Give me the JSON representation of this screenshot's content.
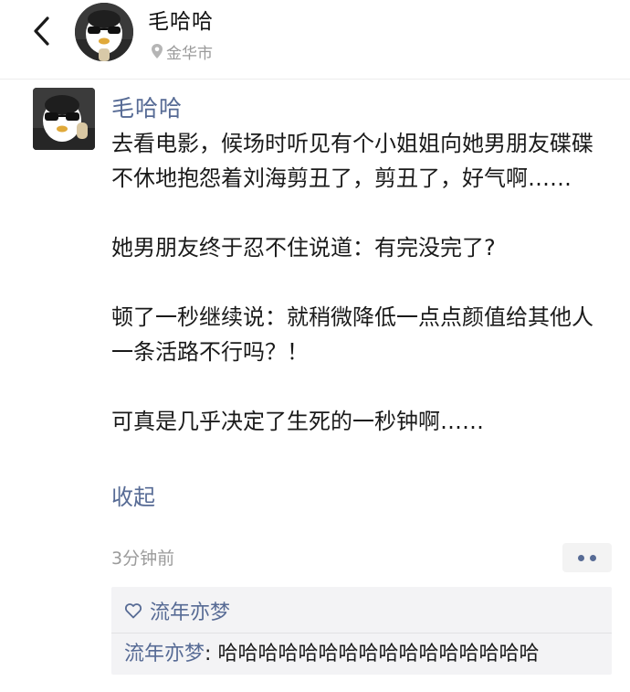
{
  "header": {
    "name": "毛哈哈",
    "location": "金华市",
    "icons": {
      "back": "chevron-left-icon",
      "location": "location-pin-icon"
    }
  },
  "post": {
    "author": "毛哈哈",
    "paragraphs": [
      "去看电影，候场时听见有个小姐姐向她男朋友碟碟不休地抱怨着刘海剪丑了，剪丑了，好气啊……",
      "她男朋友终于忍不住说道：有完没完了?",
      "顿了一秒继续说：就稍微降低一点点颜值给其他人一条活路不行吗？！",
      "可真是几乎决定了生死的一秒钟啊……"
    ],
    "collapse_label": "收起",
    "time": "3分钟前"
  },
  "interactions": {
    "likes": [
      "流年亦梦"
    ],
    "comments": [
      {
        "author": "流年亦梦",
        "separator": ":",
        "text": "哈哈哈哈哈哈哈哈哈哈哈哈哈哈哈哈"
      }
    ]
  },
  "colors": {
    "link": "#576b95",
    "text": "#1a1a1a",
    "muted": "#9b9b9b",
    "panel_bg": "#f3f3f5"
  }
}
